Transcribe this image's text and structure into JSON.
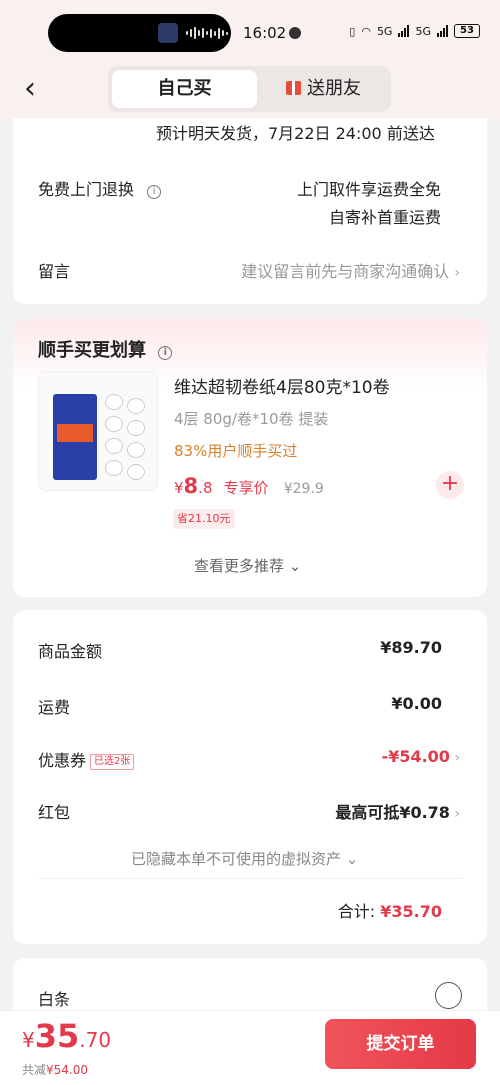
{
  "status": {
    "time": "16:02",
    "battery": "53",
    "net1": "5G",
    "net2": "5G"
  },
  "header": {
    "tab_self": "自己买",
    "tab_gift": "送朋友"
  },
  "shipping": {
    "estimate": "预计明天发货，7月22日 24:00 前送达",
    "return_label": "免费上门退换",
    "return_line1": "上门取件享运费全免",
    "return_line2": "自寄补首重运费",
    "note_label": "留言",
    "note_placeholder": "建议留言前先与商家沟通确认"
  },
  "addon": {
    "title": "顺手买更划算",
    "product_name": "维达超韧卷纸4层80克*10卷",
    "spec": "4层 80g/卷*10卷 提装",
    "popularity": "83%用户顺手买过",
    "price_symbol": "¥",
    "price_int": "8",
    "price_dec": ".8",
    "price_tag": "专享价",
    "orig_price": "¥29.9",
    "save": "省21.10元",
    "more": "查看更多推荐"
  },
  "summary": {
    "goods_label": "商品金额",
    "goods_value": "¥89.70",
    "freight_label": "运费",
    "freight_value": "¥0.00",
    "coupon_label": "优惠券",
    "coupon_badge": "已选2张",
    "coupon_value": "-¥54.00",
    "redpacket_label": "红包",
    "redpacket_value": "最高可抵¥0.78",
    "hidden_note": "已隐藏本单不可使用的虚拟资产",
    "total_label": "合计:",
    "total_value": "¥35.70"
  },
  "payment": {
    "baitiao_label": "白条"
  },
  "bottom": {
    "price_symbol": "¥",
    "price_int": "35",
    "price_dec": ".70",
    "discount_prefix": "共减",
    "discount_value": "¥54.00",
    "submit": "提交订单"
  },
  "colors": {
    "accent": "#e23a4a",
    "orange": "#d9822b"
  }
}
